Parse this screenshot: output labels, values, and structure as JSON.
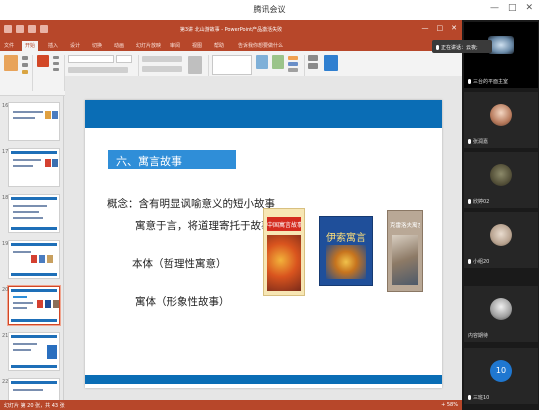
{
  "window": {
    "title": "腾讯会议",
    "controls": [
      "—",
      "□",
      "✕"
    ]
  },
  "ppt": {
    "doc_title": "第3讲 北山游故事 - PowerPoint产品激活失败",
    "tabs": [
      "文件",
      "开始",
      "插入",
      "设计",
      "切换",
      "动画",
      "幻灯片放映",
      "审阅",
      "视图",
      "帮助",
      "告诉我你想要做什么"
    ],
    "active_tab": 1,
    "status_left": "幻灯片 第 20 张，共 43 张",
    "status_right": "+ 58%"
  },
  "thumbnails": [
    {
      "num": "16"
    },
    {
      "num": "17"
    },
    {
      "num": "18"
    },
    {
      "num": "19"
    },
    {
      "num": "20"
    },
    {
      "num": "21"
    },
    {
      "num": "22"
    }
  ],
  "slide": {
    "section_title": "六、寓言故事",
    "line1": "概念：含有明显讽喻意义的短小故事",
    "line2": "寓意于言，将道理寄托于故事",
    "line3": "本体（哲理性寓意）",
    "line4": "寓体（形象性故事）",
    "books": [
      {
        "title": "中国寓言故事",
        "color": "#d42b1e"
      },
      {
        "title": "伊索寓言",
        "color": "#1f4f9a"
      },
      {
        "title": "克雷洛夫寓言",
        "color": "#8a6f5a"
      }
    ]
  },
  "meeting": {
    "speaking": "正在讲话：云夜;",
    "participants": [
      {
        "name": "三台的平面主室"
      },
      {
        "name": "张润嘉"
      },
      {
        "name": "欣婷02"
      },
      {
        "name": "小组20"
      },
      {
        "name": "内容期待"
      },
      {
        "name": "三班10",
        "avatar_text": "10",
        "avatar_color": "#1f77d0"
      }
    ]
  }
}
